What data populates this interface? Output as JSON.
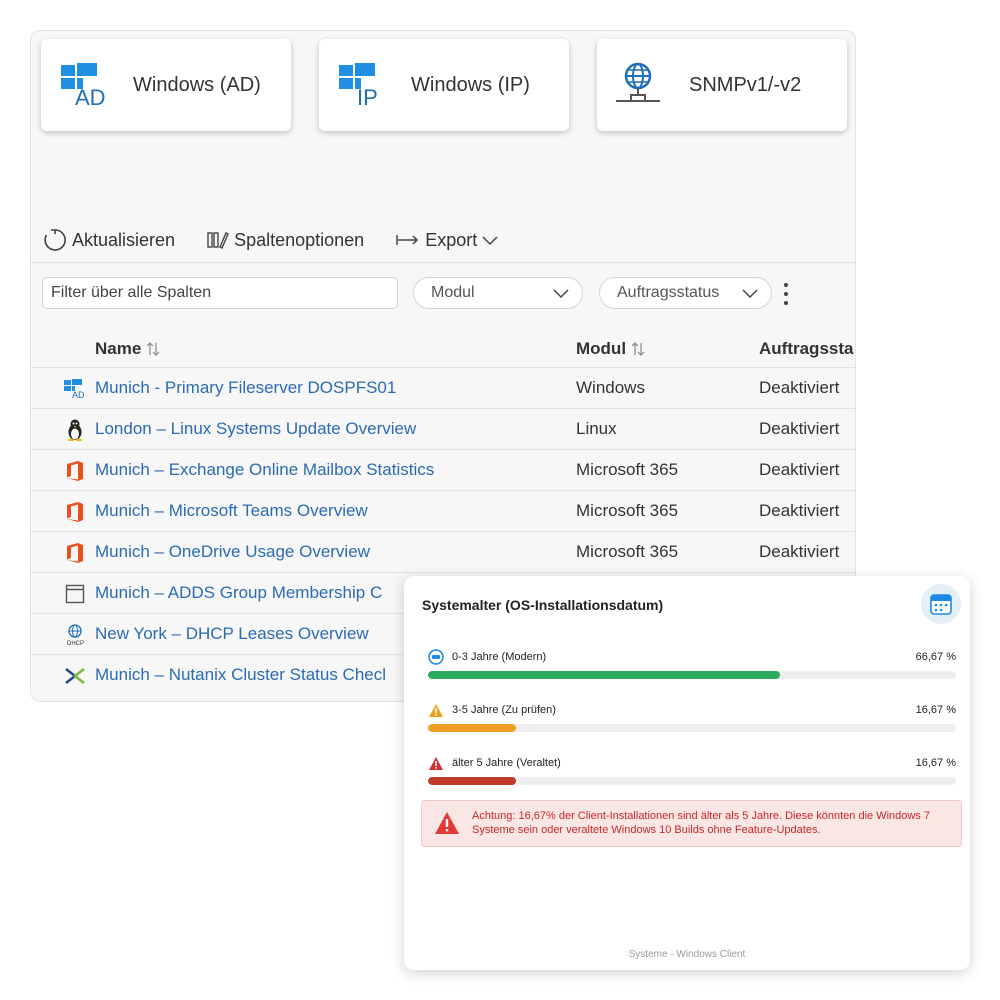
{
  "tiles": [
    {
      "label": "Windows (AD)",
      "icon": "windows-ad-icon",
      "badge": "AD"
    },
    {
      "label": "Windows (IP)",
      "icon": "windows-ip-icon",
      "badge": "IP"
    },
    {
      "label": "SNMPv1/-v2",
      "icon": "snmp-globe-icon"
    }
  ],
  "toolbar": {
    "refresh_label": "Aktualisieren",
    "columns_label": "Spaltenoptionen",
    "export_label": "Export"
  },
  "filters": {
    "search_placeholder": "Filter über alle Spalten",
    "module_label": "Modul",
    "status_label": "Auftragsstatus"
  },
  "table": {
    "columns": [
      "Name",
      "Modul",
      "Auftragssta"
    ],
    "rows": [
      {
        "icon": "windows-ad-icon",
        "name": "Munich - Primary Fileserver DOSPFS01",
        "module": "Windows",
        "status": "Deaktiviert"
      },
      {
        "icon": "linux-icon",
        "name": "London – Linux Systems Update Overview",
        "module": "Linux",
        "status": "Deaktiviert"
      },
      {
        "icon": "office-icon",
        "name": "Munich – Exchange Online Mailbox Statistics",
        "module": "Microsoft 365",
        "status": "Deaktiviert"
      },
      {
        "icon": "office-icon",
        "name": "Munich – Microsoft Teams Overview",
        "module": "Microsoft 365",
        "status": "Deaktiviert"
      },
      {
        "icon": "office-icon",
        "name": "Munich – OneDrive Usage Overview",
        "module": "Microsoft 365",
        "status": "Deaktiviert"
      },
      {
        "icon": "window-icon",
        "name": "Munich – ADDS Group Membership C",
        "module": "",
        "status": ""
      },
      {
        "icon": "dhcp-globe-icon",
        "name": "New York – DHCP Leases Overview",
        "module": "",
        "status": ""
      },
      {
        "icon": "nutanix-icon",
        "name": "Munich – Nutanix Cluster Status Checl",
        "module": "",
        "status": ""
      }
    ]
  },
  "card": {
    "title": "Systemalter (OS-Installationsdatum)",
    "metrics": [
      {
        "label": "0-3 Jahre (Modern)",
        "pct_text": "66,67 %",
        "fraction": 0.6667,
        "color": "#2eaa5c",
        "icon": "modern-badge-icon"
      },
      {
        "label": "3-5 Jahre (Zu prüfen)",
        "pct_text": "16,67 %",
        "fraction": 0.1667,
        "color": "#f0a020",
        "icon": "warning-icon"
      },
      {
        "label": "älter 5 Jahre (Veraltet)",
        "pct_text": "16,67 %",
        "fraction": 0.1667,
        "color": "#c0392b",
        "icon": "danger-icon"
      }
    ],
    "alert": "Achtung: 16,67% der Client-Installationen sind älter als 5 Jahre. Diese könnten die Windows 7 Systeme sein oder veraltete Windows 10 Builds ohne Feature-Updates.",
    "footer": "Systeme - Windows Client"
  },
  "colors": {
    "link": "#2a6bb3",
    "windows_blue": "#1e8fe1",
    "alert_red": "#c62828",
    "office_red": "#e8501d"
  }
}
